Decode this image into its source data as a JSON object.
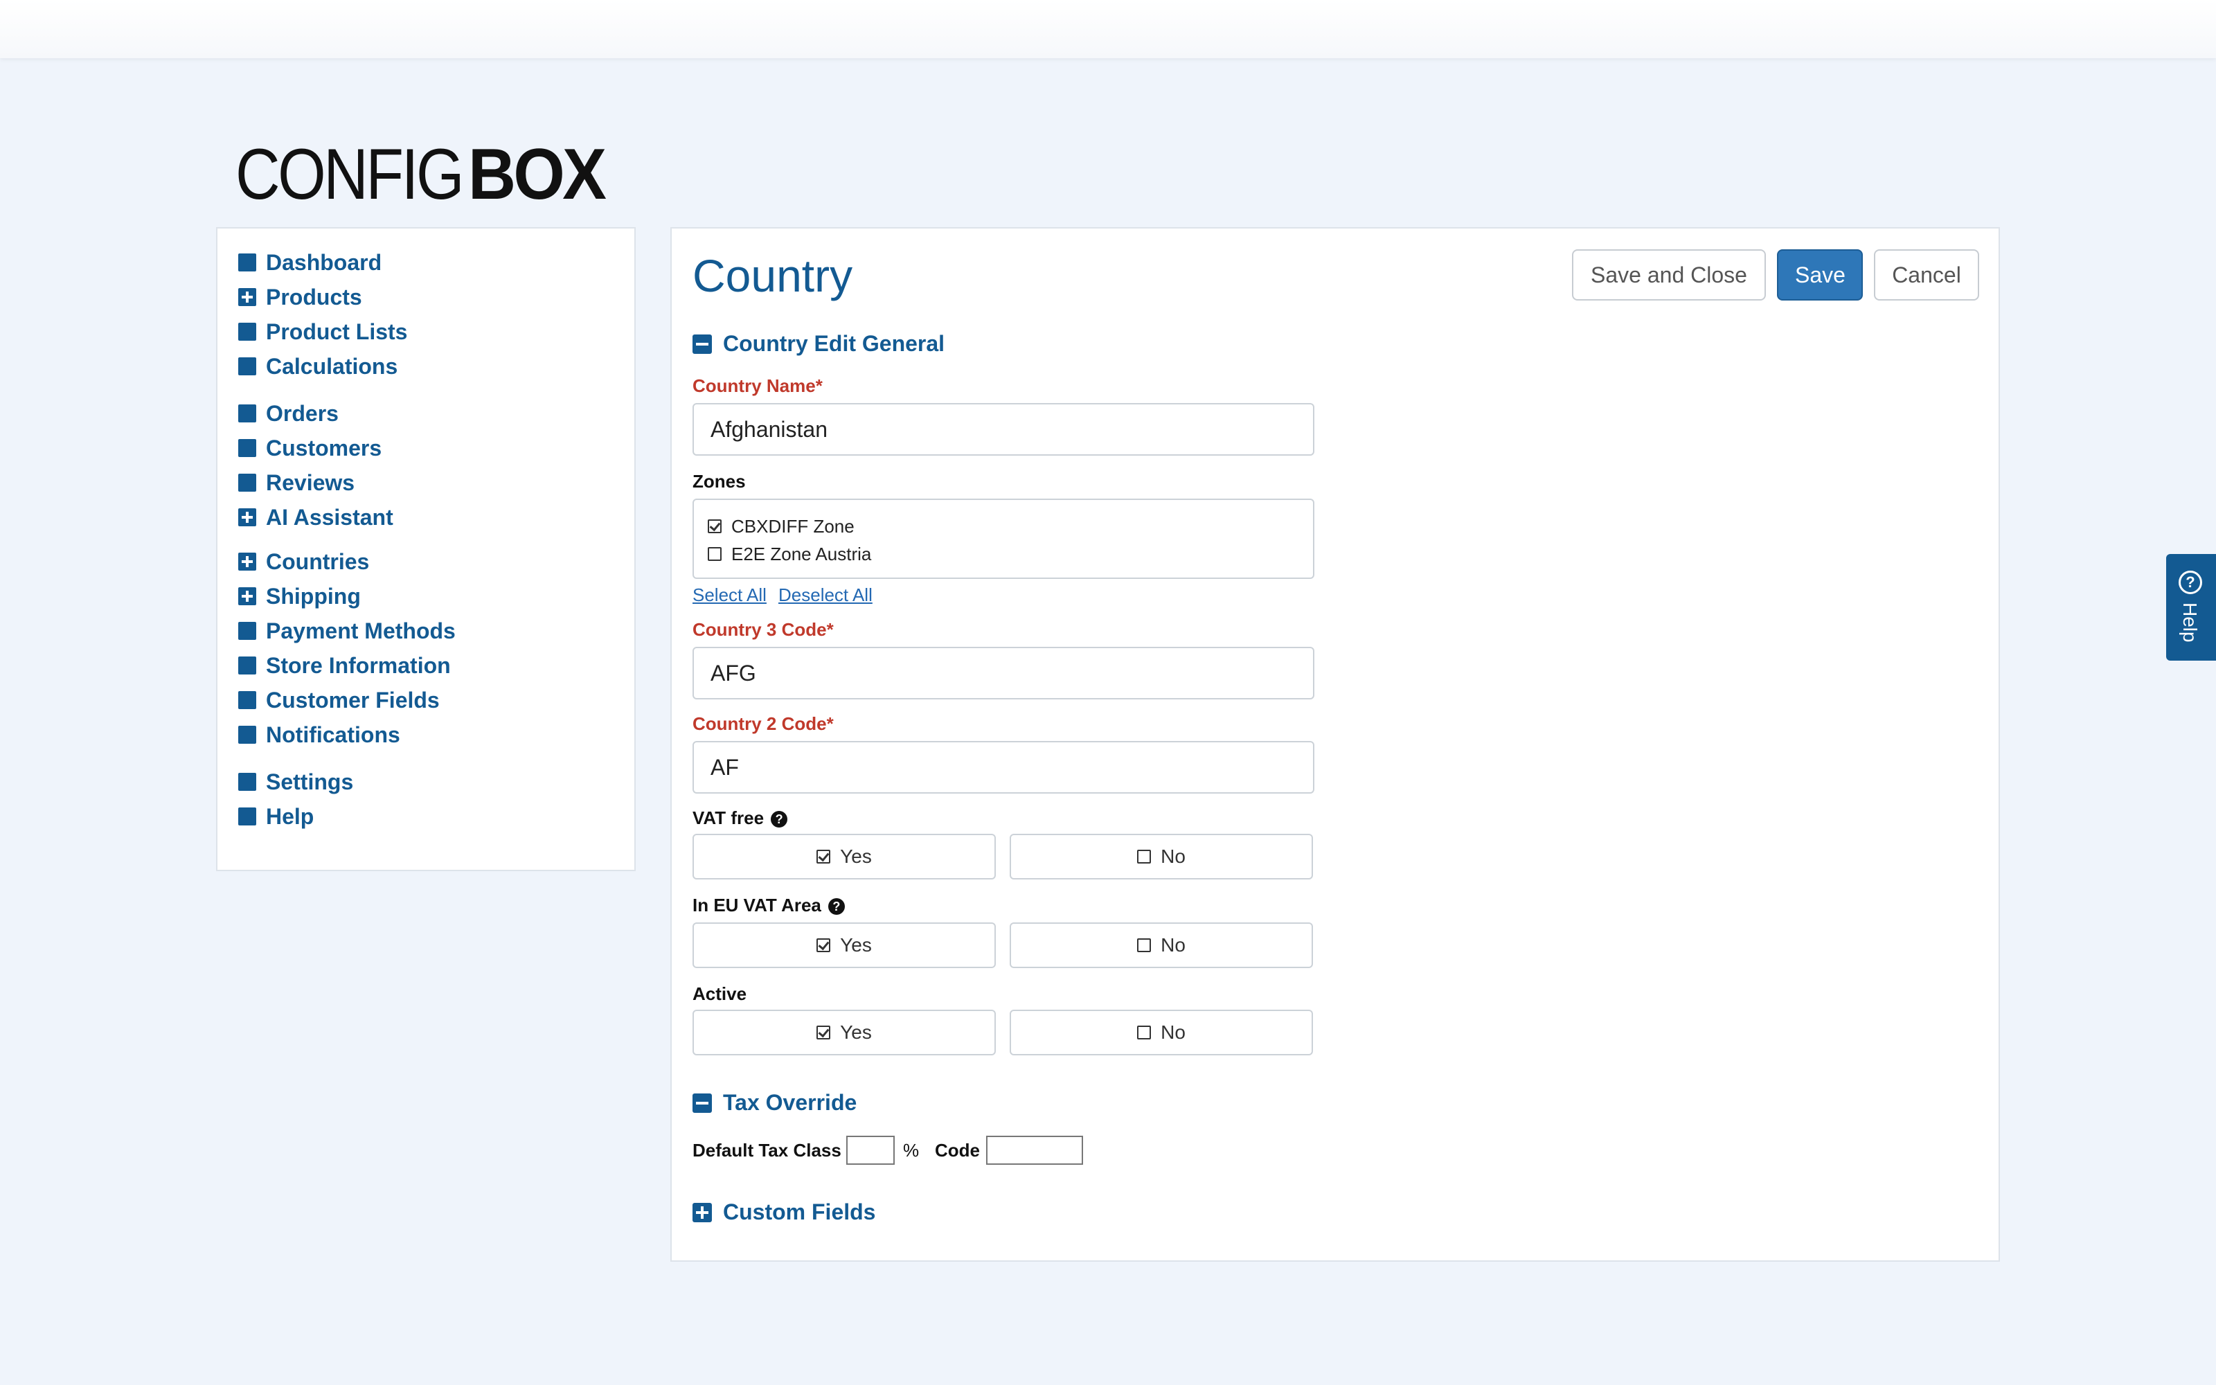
{
  "logo": {
    "thin": "CONFIG",
    "bold": "BOX"
  },
  "sidebar": {
    "groups": [
      [
        {
          "label": "Dashboard",
          "icon": "square-icon"
        },
        {
          "label": "Products",
          "icon": "plus-square-icon"
        },
        {
          "label": "Product Lists",
          "icon": "square-icon"
        },
        {
          "label": "Calculations",
          "icon": "square-icon"
        }
      ],
      [
        {
          "label": "Orders",
          "icon": "square-icon"
        },
        {
          "label": "Customers",
          "icon": "square-icon"
        },
        {
          "label": "Reviews",
          "icon": "square-icon"
        },
        {
          "label": "AI Assistant",
          "icon": "plus-square-icon"
        }
      ],
      [
        {
          "label": "Countries",
          "icon": "plus-square-icon"
        },
        {
          "label": "Shipping",
          "icon": "plus-square-icon"
        },
        {
          "label": "Payment Methods",
          "icon": "square-icon"
        },
        {
          "label": "Store Information",
          "icon": "square-icon"
        },
        {
          "label": "Customer Fields",
          "icon": "square-icon"
        },
        {
          "label": "Notifications",
          "icon": "square-icon"
        }
      ],
      [
        {
          "label": "Settings",
          "icon": "square-icon"
        },
        {
          "label": "Help",
          "icon": "square-icon"
        }
      ]
    ]
  },
  "main": {
    "title": "Country",
    "buttons": {
      "save_close": "Save and Close",
      "save": "Save",
      "cancel": "Cancel"
    },
    "section_general": "Country Edit General",
    "country_name": {
      "label": "Country Name*",
      "value": "Afghanistan"
    },
    "zones": {
      "label": "Zones",
      "items": [
        {
          "label": "CBXDIFF Zone",
          "checked": true
        },
        {
          "label": "E2E Zone Austria",
          "checked": false
        }
      ],
      "select_all": "Select All",
      "deselect_all": "Deselect All"
    },
    "country3": {
      "label": "Country 3 Code*",
      "value": "AFG"
    },
    "country2": {
      "label": "Country 2 Code*",
      "value": "AF"
    },
    "vat_free": {
      "label": "VAT free",
      "yes": "Yes",
      "no": "No",
      "selected": "yes"
    },
    "eu_vat": {
      "label": "In EU VAT Area",
      "yes": "Yes",
      "no": "No",
      "selected": "yes"
    },
    "active": {
      "label": "Active",
      "yes": "Yes",
      "no": "No",
      "selected": "yes"
    },
    "section_tax": "Tax Override",
    "tax": {
      "label": "Default Tax Class",
      "percent": "%",
      "code_label": "Code",
      "rate_value": "",
      "code_value": ""
    },
    "section_custom": "Custom Fields"
  },
  "help_tab": {
    "label": "Help",
    "icon": "question-circle-icon"
  },
  "colors": {
    "brand": "#135a92",
    "primary_button": "#2e77b8",
    "required": "#c0392b",
    "background": "#eff4fb"
  }
}
